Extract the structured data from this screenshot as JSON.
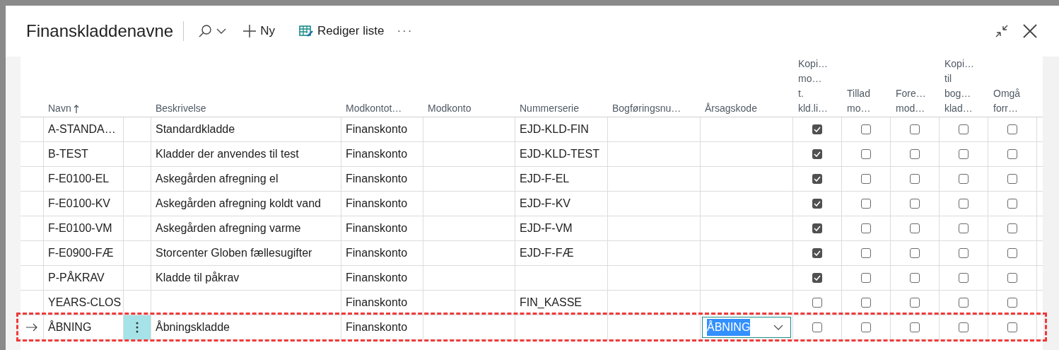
{
  "window": {
    "title": "Finanskladdenavne"
  },
  "toolbar": [
    {
      "kind": "search"
    },
    {
      "kind": "new",
      "label": "Ny"
    },
    {
      "kind": "edit",
      "label": "Rediger liste"
    },
    {
      "kind": "more",
      "label": "···"
    }
  ],
  "table": {
    "columns": [
      {
        "label": "Navn",
        "sorted": true
      },
      {
        "label": "Beskrivelse"
      },
      {
        "label": "Modkontot…"
      },
      {
        "label": "Modkonto"
      },
      {
        "label": "Nummerserie"
      },
      {
        "label": "Bogføringsnu…"
      },
      {
        "label": "Årsagskode"
      },
      {
        "label": "Kopi…\nmo…\nt.\nkld.li…"
      },
      {
        "label": "Tillad\nmo…"
      },
      {
        "label": "Fore…\nmod…"
      },
      {
        "label": "Kopi…\ntil\nbog…\nklad…"
      },
      {
        "label": "Omgå\nforr…"
      }
    ],
    "rows": [
      {
        "selected": false,
        "cells": [
          "A-STANDA…",
          "Standardkladde",
          "Finanskonto",
          "",
          "EJD-KLD-FIN",
          "",
          ""
        ],
        "checks": [
          true,
          false,
          false,
          false,
          false
        ]
      },
      {
        "selected": false,
        "cells": [
          "B-TEST",
          "Kladder der anvendes til test",
          "Finanskonto",
          "",
          "EJD-KLD-TEST",
          "",
          ""
        ],
        "checks": [
          true,
          false,
          false,
          false,
          false
        ]
      },
      {
        "selected": false,
        "cells": [
          "F-E0100-EL",
          "Askegården afregning el",
          "Finanskonto",
          "",
          "EJD-F-EL",
          "",
          ""
        ],
        "checks": [
          true,
          false,
          false,
          false,
          false
        ]
      },
      {
        "selected": false,
        "cells": [
          "F-E0100-KV",
          "Askegården afregning koldt vand",
          "Finanskonto",
          "",
          "EJD-F-KV",
          "",
          ""
        ],
        "checks": [
          true,
          false,
          false,
          false,
          false
        ]
      },
      {
        "selected": false,
        "cells": [
          "F-E0100-VM",
          "Askegården afregning varme",
          "Finanskonto",
          "",
          "EJD-F-VM",
          "",
          ""
        ],
        "checks": [
          true,
          false,
          false,
          false,
          false
        ]
      },
      {
        "selected": false,
        "cells": [
          "F-E0900-FÆ",
          "Storcenter Globen fællesugifter",
          "Finanskonto",
          "",
          "EJD-F-FÆ",
          "",
          ""
        ],
        "checks": [
          true,
          false,
          false,
          false,
          false
        ]
      },
      {
        "selected": false,
        "cells": [
          "P-PÅKRAV",
          "Kladde til påkrav",
          "Finanskonto",
          "",
          "",
          "",
          ""
        ],
        "checks": [
          true,
          false,
          false,
          false,
          false
        ]
      },
      {
        "selected": false,
        "cells": [
          "YEARS-CLOS",
          "",
          "Finanskonto",
          "",
          "FIN_KASSE",
          "",
          ""
        ],
        "checks": [
          false,
          false,
          false,
          false,
          false
        ]
      },
      {
        "selected": true,
        "cells": [
          "ÅBNING",
          "Åbningskladde",
          "Finanskonto",
          "",
          "",
          "",
          "ÅBNING"
        ],
        "checks": [
          false,
          false,
          false,
          false,
          false
        ]
      }
    ]
  }
}
